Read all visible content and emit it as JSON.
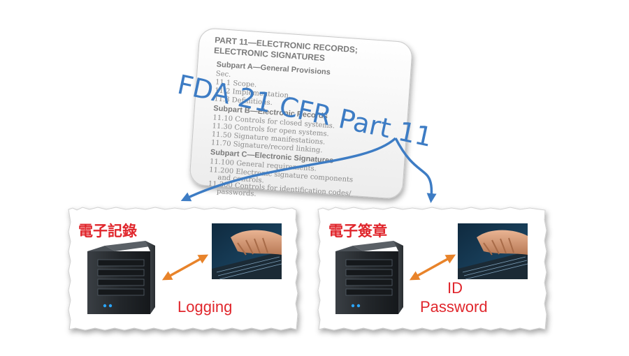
{
  "document": {
    "heading_1": "PART 11—ELECTRONIC RECORDS;",
    "heading_2": "ELECTRONIC SIGNATURES",
    "subpart_a": "Subpart A—General Provisions",
    "sec": "Sec.",
    "lines_a": [
      "11.1    Scope.",
      "11.2    Implementation.",
      "11.3    Definitions."
    ],
    "subpart_b": "Subpart B—Electronic Records",
    "lines_b": [
      "11.10   Controls for closed systems.",
      "11.30   Controls for open systems.",
      "11.50   Signature manifestations.",
      "11.70   Signature/record linking."
    ],
    "subpart_c": "Subpart C—Electronic Signatures",
    "lines_c": [
      "11.100  General requirements.",
      "11.200  Electronic signature components",
      "and controls.",
      "11.300  Controls for identification codes/",
      "passwords."
    ]
  },
  "title": "FDA 21 CFR Part 11",
  "left_box": {
    "label": "電子記錄",
    "caption": "Logging"
  },
  "right_box": {
    "label": "電子簽章",
    "caption_1": "ID",
    "caption_2": "Password"
  },
  "colors": {
    "title_blue": "#3d7cc4",
    "label_red": "#e0262c",
    "arrow_orange": "#e8832a"
  }
}
